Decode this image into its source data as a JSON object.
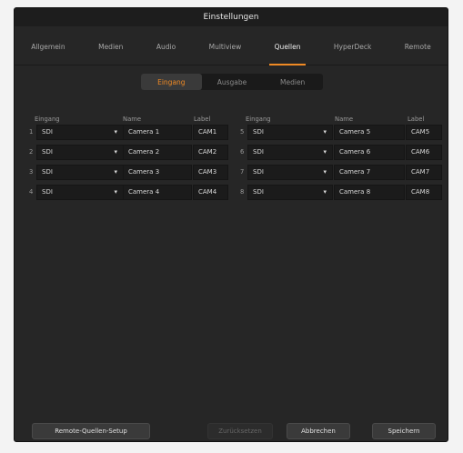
{
  "window": {
    "title": "Einstellungen"
  },
  "tabs": [
    {
      "label": "Allgemein"
    },
    {
      "label": "Medien"
    },
    {
      "label": "Audio"
    },
    {
      "label": "Multiview"
    },
    {
      "label": "Quellen"
    },
    {
      "label": "HyperDeck"
    },
    {
      "label": "Remote"
    }
  ],
  "segments": [
    {
      "label": "Eingang"
    },
    {
      "label": "Ausgabe"
    },
    {
      "label": "Medien"
    }
  ],
  "headers": {
    "eingang": "Eingang",
    "name": "Name",
    "label": "Label"
  },
  "rows_left": [
    {
      "num": "1",
      "source": "SDI",
      "name": "Camera 1",
      "label": "CAM1"
    },
    {
      "num": "2",
      "source": "SDI",
      "name": "Camera 2",
      "label": "CAM2"
    },
    {
      "num": "3",
      "source": "SDI",
      "name": "Camera 3",
      "label": "CAM3"
    },
    {
      "num": "4",
      "source": "SDI",
      "name": "Camera 4",
      "label": "CAM4"
    }
  ],
  "rows_right": [
    {
      "num": "5",
      "source": "SDI",
      "name": "Camera 5",
      "label": "CAM5"
    },
    {
      "num": "6",
      "source": "SDI",
      "name": "Camera 6",
      "label": "CAM6"
    },
    {
      "num": "7",
      "source": "SDI",
      "name": "Camera 7",
      "label": "CAM7"
    },
    {
      "num": "8",
      "source": "SDI",
      "name": "Camera 8",
      "label": "CAM8"
    }
  ],
  "buttons": {
    "remote_setup": "Remote-Quellen-Setup",
    "reset": "Zurücksetzen",
    "cancel": "Abbrechen",
    "save": "Speichern"
  },
  "colors": {
    "accent": "#f08a24",
    "panel": "#262626"
  }
}
